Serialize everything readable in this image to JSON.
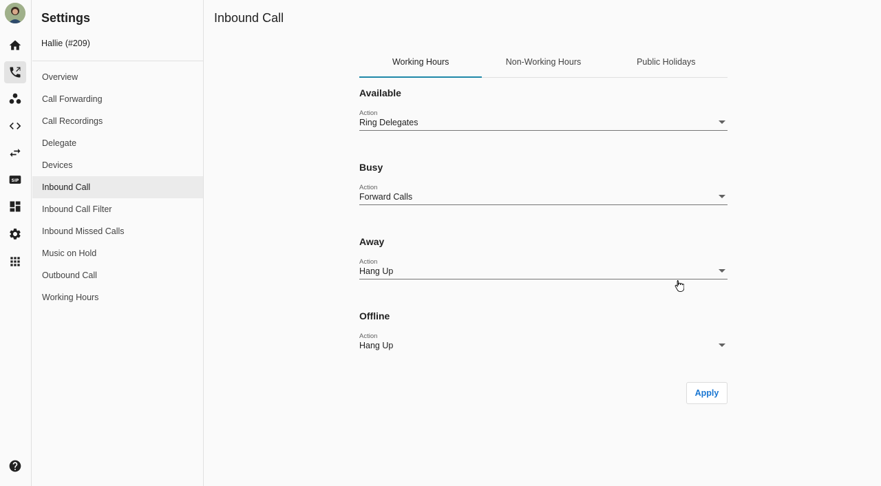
{
  "rail": {
    "items": [
      {
        "icon": "home-icon"
      },
      {
        "icon": "phone-icon",
        "active": true
      },
      {
        "icon": "people-icon"
      },
      {
        "icon": "code-icon"
      },
      {
        "icon": "swap-icon"
      },
      {
        "icon": "sip-icon"
      },
      {
        "icon": "dashboard-icon"
      },
      {
        "icon": "gear-icon"
      },
      {
        "icon": "apps-grid-icon"
      }
    ],
    "help_icon": "help-icon"
  },
  "sidebar": {
    "title": "Settings",
    "user": "Hallie (#209)",
    "items": [
      {
        "label": "Overview"
      },
      {
        "label": "Call Forwarding"
      },
      {
        "label": "Call Recordings"
      },
      {
        "label": "Delegate"
      },
      {
        "label": "Devices"
      },
      {
        "label": "Inbound Call",
        "active": true
      },
      {
        "label": "Inbound Call Filter"
      },
      {
        "label": "Inbound Missed Calls"
      },
      {
        "label": "Music on Hold"
      },
      {
        "label": "Outbound Call"
      },
      {
        "label": "Working Hours"
      }
    ]
  },
  "main": {
    "title": "Inbound Call",
    "tabs": [
      {
        "label": "Working Hours",
        "active": true
      },
      {
        "label": "Non-Working Hours"
      },
      {
        "label": "Public Holidays"
      }
    ],
    "sections": [
      {
        "heading": "Available",
        "field_label": "Action",
        "value": "Ring Delegates"
      },
      {
        "heading": "Busy",
        "field_label": "Action",
        "value": "Forward Calls"
      },
      {
        "heading": "Away",
        "field_label": "Action",
        "value": "Hang Up"
      },
      {
        "heading": "Offline",
        "field_label": "Action",
        "value": "Hang Up"
      }
    ],
    "apply_label": "Apply"
  },
  "colors": {
    "accent_tab": "#1e88a8",
    "button_text": "#1976d2"
  }
}
